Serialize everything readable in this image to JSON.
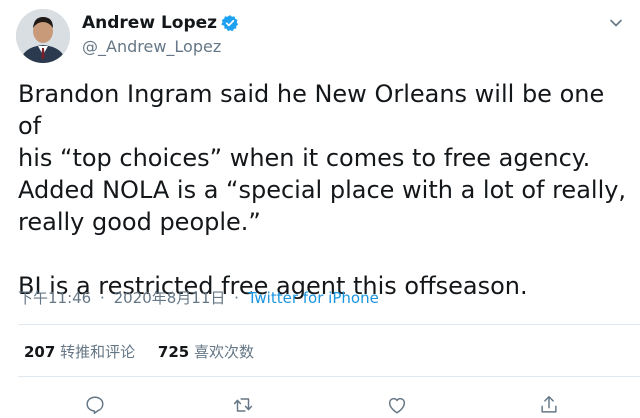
{
  "author": {
    "display_name": "Andrew Lopez",
    "handle": "@_Andrew_Lopez",
    "verified": true
  },
  "tweet": {
    "text": "Brandon Ingram said he New Orleans will be one of\nhis “top choices” when it comes to free agency.\nAdded NOLA is a “special place with a lot of really,\nreally good people.”\n\nBI is a restricted free agent this offseason.",
    "time": "下午11:46",
    "date": "2020年8月11日",
    "separator": "·",
    "source": "Twitter for iPhone"
  },
  "stats": {
    "retweets_count": "207",
    "retweets_label": "转推和评论",
    "likes_count": "725",
    "likes_label": "喜欢次数"
  },
  "actions": [
    "reply-icon",
    "retweet-icon",
    "like-icon",
    "share-icon"
  ],
  "colors": {
    "link": "#1b95e0",
    "verified": "#1da1f2",
    "secondary_text": "#657786",
    "divider": "#e1e8ed"
  }
}
